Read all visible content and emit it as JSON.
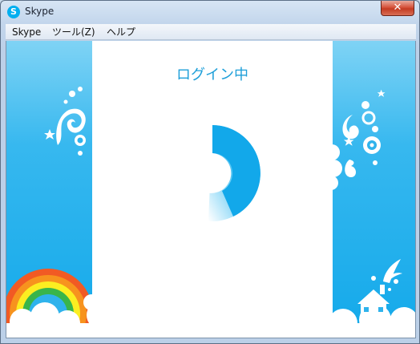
{
  "window": {
    "title": "Skype",
    "app_icon_glyph": "S",
    "close_glyph": "✕"
  },
  "menu": {
    "items": [
      {
        "label": "Skype"
      },
      {
        "label": "ツール(Z)"
      },
      {
        "label": "ヘルプ"
      }
    ]
  },
  "main": {
    "status": "ログイン中"
  },
  "colors": {
    "accent": "#00aff0",
    "status_text": "#1e9fd9",
    "sky_top": "#7fd3f5",
    "sky_bottom": "#13a9ea"
  },
  "icons": [
    "skype-logo-icon",
    "close-icon",
    "loading-spinner-icon",
    "rainbow-icon",
    "house-icon"
  ]
}
